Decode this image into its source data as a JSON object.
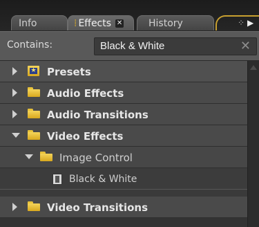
{
  "tabs": {
    "info": "Info",
    "effects": "Effects",
    "history": "History"
  },
  "search": {
    "label": "Contains:",
    "value": "Black & White"
  },
  "tree": {
    "presets": "Presets",
    "audio_effects": "Audio Effects",
    "audio_transitions": "Audio Transitions",
    "video_effects": "Video Effects",
    "image_control": "Image Control",
    "black_white": "Black & White",
    "video_transitions": "Video Transitions"
  },
  "colors": {
    "accent": "#c8a030",
    "folder": "#e8c23a",
    "panel_bg": "#3a3a3a"
  }
}
